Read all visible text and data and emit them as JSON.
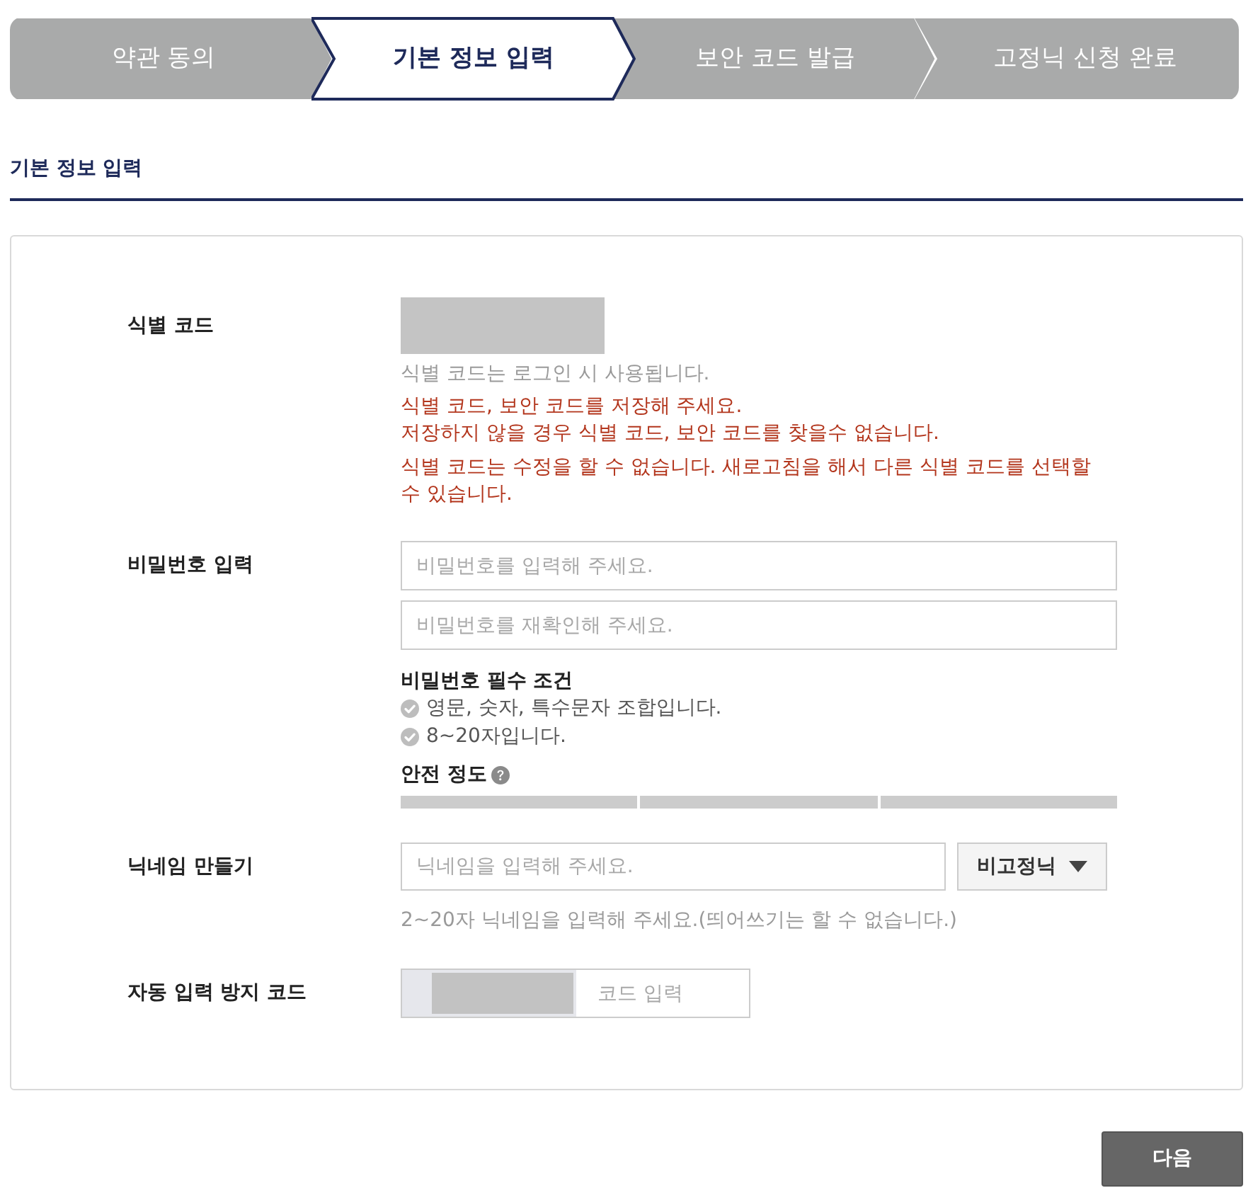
{
  "steps": [
    {
      "label": "약관 동의",
      "selected": false
    },
    {
      "label": "기본 정보 입력",
      "selected": true
    },
    {
      "label": "보안 코드 발급",
      "selected": false
    },
    {
      "label": "고정닉 신청 완료",
      "selected": false
    }
  ],
  "section_title": "기본 정보 입력",
  "form": {
    "identification_code": {
      "label": "식별 코드",
      "notes": [
        {
          "kind": "hint",
          "lines": [
            "식별 코드는 로그인 시 사용됩니다."
          ]
        },
        {
          "kind": "warning",
          "lines": [
            "식별 코드, 보안 코드를 저장해 주세요.",
            "저장하지 않을 경우 식별 코드, 보안 코드를 찾을수 없습니다."
          ]
        },
        {
          "kind": "warning",
          "lines": [
            "식별 코드는 수정을 할 수 없습니다. 새로고침을 해서 다른 식별 코드를 선택할 수 있습니다."
          ]
        }
      ]
    },
    "password": {
      "label": "비밀번호 입력",
      "fields": [
        {
          "placeholder": "비밀번호를 입력해 주세요."
        },
        {
          "placeholder": "비밀번호를 재확인해 주세요."
        }
      ],
      "requirements_title": "비밀번호 필수 조건",
      "requirements": [
        {
          "text": "영문, 숫자, 특수문자 조합입니다.",
          "met": false
        },
        {
          "text": "8~20자입니다.",
          "met": false
        }
      ],
      "strength_label": "안전 정도"
    },
    "nickname": {
      "label": "닉네임 만들기",
      "field": {
        "placeholder": "닉네임을 입력해 주세요."
      },
      "type_dropdown": {
        "value": "비고정닉"
      },
      "hint": "2~20자 닉네임을 입력해 주세요.(띄어쓰기는 할 수 없습니다.)"
    },
    "captcha": {
      "label": "자동 입력 방지 코드",
      "field": {
        "placeholder": "코드 입력"
      }
    }
  },
  "next_button": "다음"
}
